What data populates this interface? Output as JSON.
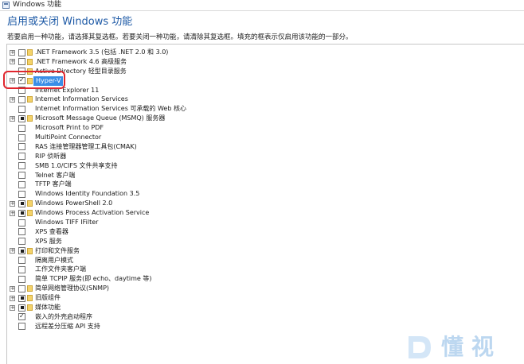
{
  "window": {
    "title": "Windows 功能",
    "heading": "启用或关闭 Windows 功能",
    "description": "若要启用一种功能，请选择其复选框。若要关闭一种功能，请清除其复选框。填充的框表示仅启用该功能的一部分。"
  },
  "features": [
    {
      "label": ".NET Framework 3.5 (包括 .NET 2.0 和 3.0)",
      "expandable": true,
      "state": "unchecked",
      "folder": true
    },
    {
      "label": ".NET Framework 4.6 高级服务",
      "expandable": true,
      "state": "unchecked",
      "folder": true
    },
    {
      "label": "Active Directory 轻型目录服务",
      "expandable": false,
      "state": "unchecked",
      "folder": true
    },
    {
      "label": "Hyper-V",
      "expandable": true,
      "state": "checked",
      "folder": true,
      "selected": true
    },
    {
      "label": "Internet Explorer 11",
      "expandable": false,
      "state": "unchecked",
      "folder": false
    },
    {
      "label": "Internet Information Services",
      "expandable": true,
      "state": "unchecked",
      "folder": true
    },
    {
      "label": "Internet Information Services 可承载的 Web 核心",
      "expandable": false,
      "state": "unchecked",
      "folder": false
    },
    {
      "label": "Microsoft Message Queue (MSMQ) 服务器",
      "expandable": true,
      "state": "partial",
      "folder": true
    },
    {
      "label": "Microsoft Print to PDF",
      "expandable": false,
      "state": "unchecked",
      "folder": false
    },
    {
      "label": "MultiPoint Connector",
      "expandable": false,
      "state": "unchecked",
      "folder": false
    },
    {
      "label": "RAS 连接管理器管理工具包(CMAK)",
      "expandable": false,
      "state": "unchecked",
      "folder": false
    },
    {
      "label": "RIP 侦听器",
      "expandable": false,
      "state": "unchecked",
      "folder": false
    },
    {
      "label": "SMB 1.0/CIFS 文件共享支持",
      "expandable": false,
      "state": "unchecked",
      "folder": false
    },
    {
      "label": "Telnet 客户端",
      "expandable": false,
      "state": "unchecked",
      "folder": false
    },
    {
      "label": "TFTP 客户端",
      "expandable": false,
      "state": "unchecked",
      "folder": false
    },
    {
      "label": "Windows Identity Foundation 3.5",
      "expandable": false,
      "state": "unchecked",
      "folder": false
    },
    {
      "label": "Windows PowerShell 2.0",
      "expandable": true,
      "state": "partial",
      "folder": true
    },
    {
      "label": "Windows Process Activation Service",
      "expandable": true,
      "state": "partial",
      "folder": true
    },
    {
      "label": "Windows TIFF IFilter",
      "expandable": false,
      "state": "unchecked",
      "folder": false
    },
    {
      "label": "XPS 查看器",
      "expandable": false,
      "state": "unchecked",
      "folder": false
    },
    {
      "label": "XPS 服务",
      "expandable": false,
      "state": "unchecked",
      "folder": false
    },
    {
      "label": "打印和文件服务",
      "expandable": true,
      "state": "partial",
      "folder": true
    },
    {
      "label": "隔离用户模式",
      "expandable": false,
      "state": "unchecked",
      "folder": false
    },
    {
      "label": "工作文件夹客户端",
      "expandable": false,
      "state": "unchecked",
      "folder": false
    },
    {
      "label": "简单 TCPIP 服务(即 echo、daytime 等)",
      "expandable": false,
      "state": "unchecked",
      "folder": false
    },
    {
      "label": "简单网络管理协议(SNMP)",
      "expandable": true,
      "state": "unchecked",
      "folder": true
    },
    {
      "label": "旧版组件",
      "expandable": true,
      "state": "partial",
      "folder": true
    },
    {
      "label": "媒体功能",
      "expandable": true,
      "state": "partial",
      "folder": true
    },
    {
      "label": "嵌入的外壳启动程序",
      "expandable": false,
      "state": "checked",
      "folder": false
    },
    {
      "label": "远程差分压缩 API 支持",
      "expandable": false,
      "state": "unchecked",
      "folder": false
    }
  ],
  "watermark": {
    "text": "懂视"
  },
  "colors": {
    "heading": "#1e5aa6",
    "selection": "#3a8ee6",
    "annotation_ring": "#e0262e",
    "folder": "#f4d36a"
  }
}
